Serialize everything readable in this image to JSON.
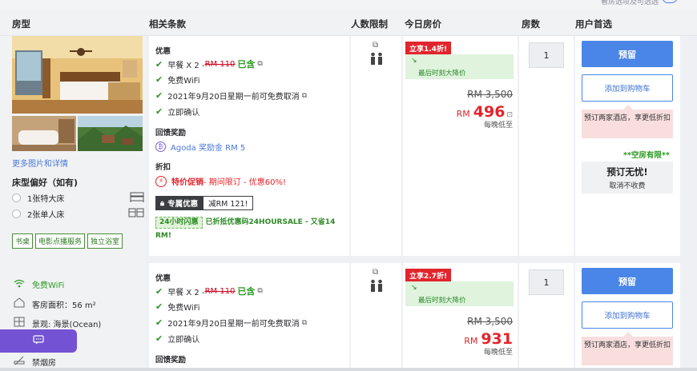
{
  "top": {
    "text": "看房选项及可选选"
  },
  "headers": {
    "room_type": "房型",
    "terms": "相关条款",
    "occupancy": "人数限制",
    "today_price": "今日房价",
    "rooms": "房数",
    "user_pref": "用户首选"
  },
  "room": {
    "more_photos": "更多图片和详情",
    "bed_pref_title": "床型偏好（如有)",
    "beds": [
      "1张特大床",
      "2张单人床"
    ],
    "tags": [
      "书桌",
      "电影点播服务",
      "独立浴室"
    ],
    "features": [
      {
        "icon": "wifi-icon",
        "label": "免费WiFi"
      },
      {
        "icon": "house-icon",
        "label": "客房面积：56 m²"
      },
      {
        "icon": "window-icon",
        "label": "景观: 海景(Ocean)"
      },
      {
        "icon": "no-smoking-icon",
        "label": "禁烟房"
      }
    ]
  },
  "offers": [
    {
      "benefit_title": "优惠",
      "breakfast_label": "早餐 X 2 - ",
      "breakfast_old": "RM 110",
      "breakfast_incl": "已含",
      "wifi": "免费WiFi",
      "free_cancel": "2021年9月20日星期一前可免费取消",
      "instant": "立即确认",
      "reward_title": "回馈奖励",
      "reward": "Agoda 奖励金 RM 5",
      "discount_title": "折扣",
      "promo_label": "特价促销",
      "promo_text": " - 期间限订 - 优惠60%!",
      "coupon_label": "专属优惠",
      "coupon_value": "减RM 121!",
      "hour24_badge": "24小时闪惠",
      "hour24_text": "已折抵优惠码24HOURSALE - 又省14 RM!",
      "deal_badge": "立享1.4折!",
      "last_minute": "最后时刻大降价",
      "old_price": "RM 3,500",
      "currency": "RM",
      "price": "496",
      "per_night": "每晚低至",
      "qty": "1",
      "reserve": "预留",
      "add_cart": "添加到购物车",
      "two_hotel": "预订两家酒店，享更低折扣",
      "limited": "**空房有限**",
      "worry_title": "预订无忧!",
      "worry_sub": "取消不收费"
    },
    {
      "benefit_title": "优惠",
      "breakfast_label": "早餐 X 2 - ",
      "breakfast_old": "RM 110",
      "breakfast_incl": "已含",
      "wifi": "免费WiFi",
      "free_cancel": "2021年9月20日星期一前可免费取消",
      "instant": "立即确认",
      "reward_title": "回馈奖励",
      "deal_badge": "立享2.7折!",
      "last_minute": "最后时刻大降价",
      "old_price": "RM 3,500",
      "currency": "RM",
      "price": "931",
      "per_night": "每晚低至",
      "qty": "1",
      "reserve": "预留",
      "add_cart": "添加到购物车",
      "two_hotel": "预订两家酒店，享更低折扣"
    }
  ],
  "colors": {
    "accent": "#4a86e8",
    "deal_red": "#e1252d",
    "green": "#2d9a24",
    "chat": "#7352d3"
  }
}
